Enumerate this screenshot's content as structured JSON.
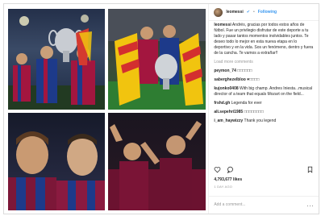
{
  "header": {
    "username": "leomessi",
    "follow_label": "Following",
    "separator": "•"
  },
  "caption": {
    "username": "leomessi",
    "text": "Andrés, gracias por todos estos años de fútbol. Fue un privilegio disfrutar de este deporte a tu lado y pasar tantos momentos inolvidables juntos. Te deseo todo lo mejor en esta nueva etapa en lo deportivo y en la vida. Sos un fenómeno, dentro y fuera de la cancha. Te vamos a extrañar!!"
  },
  "load_more": "Load more comments",
  "comments": [
    {
      "user": "peymon_74",
      "text": "□□□□□□"
    },
    {
      "user": "saberghezelbloo",
      "text": "♥□□□□"
    },
    {
      "user": "kujonko0408",
      "text": "With big champ. Andres Iniesta...musical director of a team that equals Mozart on the field..."
    },
    {
      "user": "frshd.gh",
      "text": "Legenda for ever"
    },
    {
      "user": "ali.sepehri1985",
      "text": "□□□□□□□□"
    },
    {
      "user": "i_am_haywizzy",
      "text": "Thank you legend"
    }
  ],
  "likes": "4,793,677 likes",
  "time": "1 DAY AGO",
  "add_comment_placeholder": "Add a comment...",
  "more_label": "..."
}
